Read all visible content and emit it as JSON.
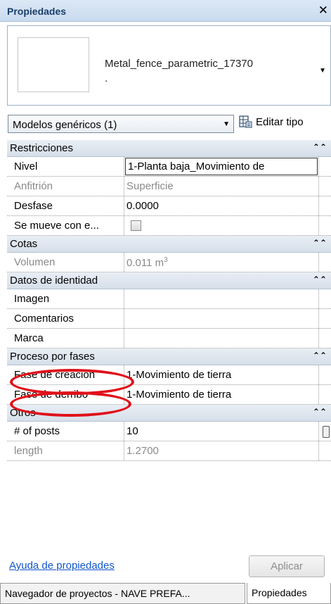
{
  "panel": {
    "title": "Propiedades"
  },
  "type_selector": {
    "type_name": "Metal_fence_parametric_17370",
    "type_suffix": "."
  },
  "filter": {
    "category_label": "Modelos genéricos (1)",
    "edit_type_label": "Editar tipo"
  },
  "sections": {
    "restricciones": {
      "label": "Restricciones",
      "rows": [
        {
          "name": "Nivel",
          "value": "1-Planta baja_Movimiento de"
        },
        {
          "name": "Anfitrión",
          "value": "Superficie"
        },
        {
          "name": "Desfase",
          "value": "0.0000"
        },
        {
          "name": "Se mueve con e...",
          "value": ""
        }
      ]
    },
    "cotas": {
      "label": "Cotas",
      "rows": [
        {
          "name": "Volumen",
          "value": "0.011 m",
          "unit_sup": "3"
        }
      ]
    },
    "identidad": {
      "label": "Datos de identidad",
      "rows": [
        {
          "name": "Imagen",
          "value": ""
        },
        {
          "name": "Comentarios",
          "value": ""
        },
        {
          "name": "Marca",
          "value": ""
        }
      ]
    },
    "fases": {
      "label": "Proceso por fases",
      "rows": [
        {
          "name": "Fase de creación",
          "value": "1-Movimiento de tierra"
        },
        {
          "name": "Fase de derribo",
          "value": "1-Movimiento de tierra"
        }
      ]
    },
    "otros": {
      "label": "Otros",
      "rows": [
        {
          "name": "# of posts",
          "value": "10"
        },
        {
          "name": "length",
          "value": "1.2700"
        }
      ]
    }
  },
  "footer": {
    "help_link": "Ayuda de propiedades",
    "apply_label": "Aplicar"
  },
  "tabs": [
    {
      "label": "Navegador de proyectos - NAVE PREFA..."
    },
    {
      "label": "Propiedades"
    }
  ],
  "icons": {
    "close": "close-icon",
    "collapse": "chevron-up-double-icon",
    "dropdown": "triangle-down-icon",
    "edit_type": "edit-type-icon"
  },
  "colors": {
    "annotation": "#e0101a",
    "header_gradient": "#d6dfea",
    "link": "#1155cc"
  }
}
